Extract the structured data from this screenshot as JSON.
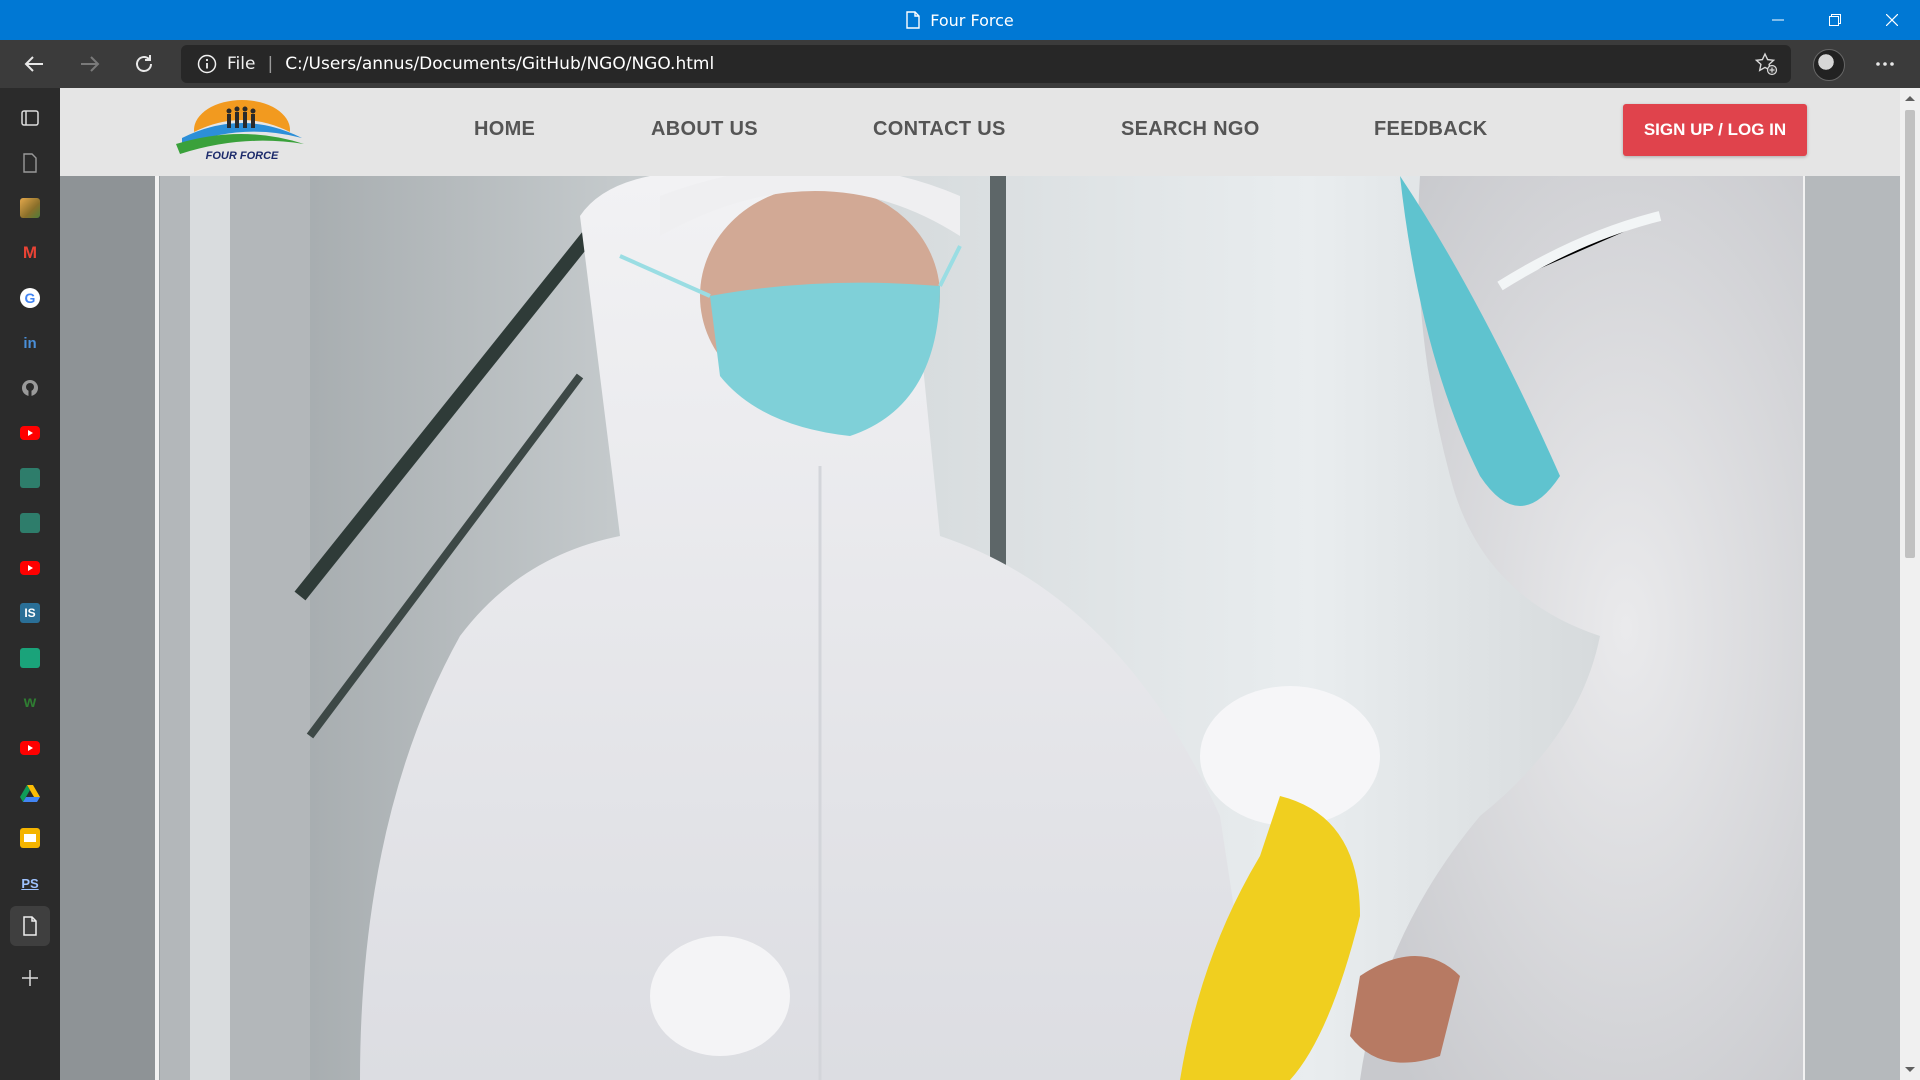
{
  "window": {
    "title": "Four Force",
    "controls": [
      "minimize-icon",
      "restore-icon",
      "close-icon"
    ]
  },
  "toolbar": {
    "back_icon": "back-arrow-icon",
    "forward_icon": "forward-arrow-icon",
    "refresh_icon": "refresh-icon",
    "address": {
      "scheme_label": "File",
      "separator": "|",
      "url": "C:/Users/annus/Documents/GitHub/NGO/NGO.html"
    },
    "favorite_icon": "add-favorite-icon",
    "more_icon": "more-icon"
  },
  "sidebar": {
    "items": [
      {
        "icon": "tab-actions-icon"
      },
      {
        "icon": "page-icon"
      },
      {
        "icon": "colorful-app-icon"
      },
      {
        "icon": "gmail-icon",
        "glyph": "M",
        "color": "#ea4335"
      },
      {
        "icon": "google-icon",
        "glyph": "G",
        "color": "#4285f4"
      },
      {
        "icon": "linkedin-icon",
        "glyph": "in",
        "color": "#0a66c2"
      },
      {
        "icon": "github-icon"
      },
      {
        "icon": "youtube-icon",
        "color": "#ff0000"
      },
      {
        "icon": "app-green-icon",
        "color": "#2e7d6b"
      },
      {
        "icon": "app-green-icon-2",
        "color": "#2e7d6b"
      },
      {
        "icon": "youtube-icon-2",
        "color": "#ff0000"
      },
      {
        "icon": "is-icon",
        "glyph": "IS",
        "color": "#2a6f97"
      },
      {
        "icon": "app-teal-icon",
        "color": "#1aa37a"
      },
      {
        "icon": "w-icon",
        "glyph": "w",
        "color": "#2f7d32"
      },
      {
        "icon": "youtube-icon-3",
        "color": "#ff0000"
      },
      {
        "icon": "google-drive-icon"
      },
      {
        "icon": "slides-icon",
        "color": "#f4b400"
      },
      {
        "icon": "ps-icon",
        "glyph": "PS",
        "color": "#0c2b5c"
      },
      {
        "icon": "current-page-icon"
      },
      {
        "icon": "add-icon",
        "glyph": "+"
      }
    ]
  },
  "site": {
    "logo_text": "FOUR FORCE",
    "nav": [
      "HOME",
      "ABOUT US",
      "CONTACT US",
      "SEARCH NGO",
      "FEEDBACK"
    ],
    "cta": "SIGN UP / LOG IN",
    "colors": {
      "header_bg": "#e5e5e5",
      "nav_text": "#555555",
      "cta_bg": "#e0434c",
      "accent": "#0078d4"
    }
  }
}
